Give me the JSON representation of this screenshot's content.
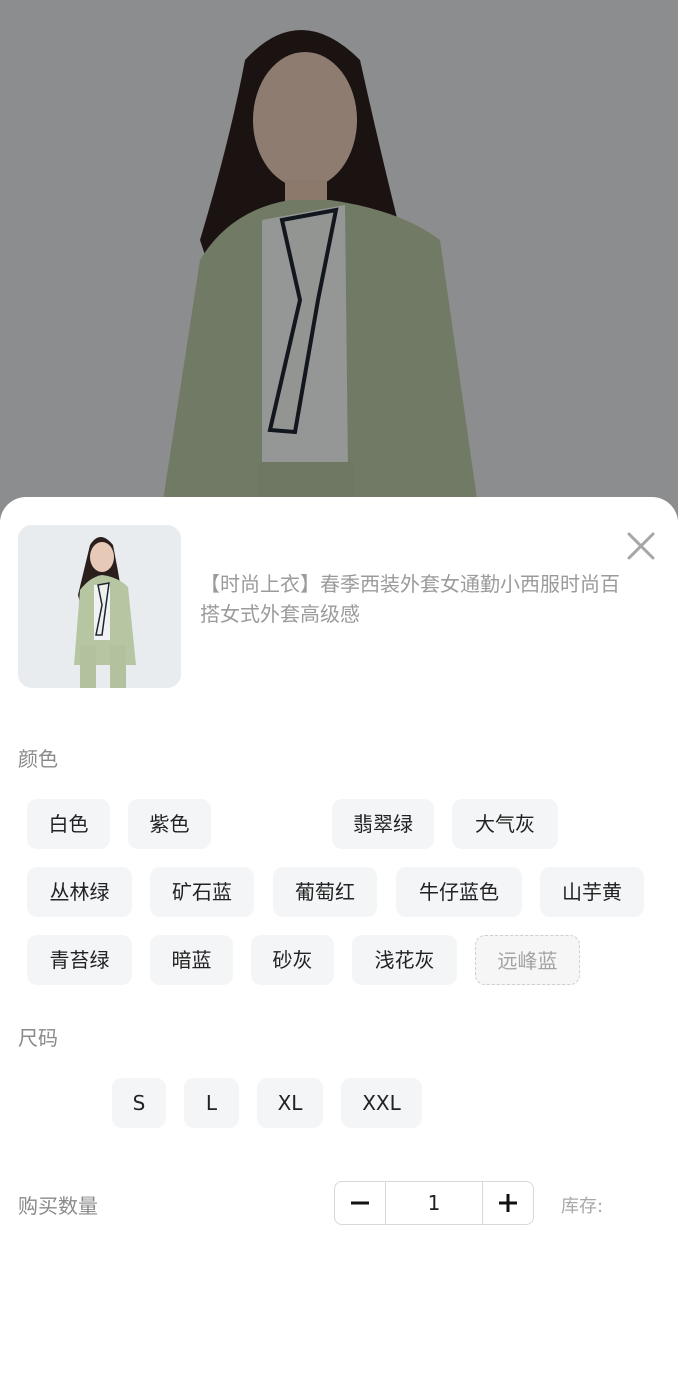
{
  "product": {
    "title": "【时尚上衣】春季西装外套女通勤小西服时尚百搭女式外套高级感",
    "image_icon": "product-photo"
  },
  "close_icon": "close-icon",
  "color": {
    "label": "颜色",
    "options": [
      {
        "label": "白色",
        "available": true
      },
      {
        "label": "紫色",
        "available": true
      },
      {
        "label": "翡翠绿",
        "available": true
      },
      {
        "label": "大气灰",
        "available": true
      },
      {
        "label": "丛林绿",
        "available": true
      },
      {
        "label": "矿石蓝",
        "available": true
      },
      {
        "label": "葡萄红",
        "available": true
      },
      {
        "label": "牛仔蓝色",
        "available": true
      },
      {
        "label": "山芋黄",
        "available": true
      },
      {
        "label": "青苔绿",
        "available": true
      },
      {
        "label": "暗蓝",
        "available": true
      },
      {
        "label": "砂灰",
        "available": true
      },
      {
        "label": "浅花灰",
        "available": true
      },
      {
        "label": "远峰蓝",
        "available": false
      }
    ]
  },
  "size": {
    "label": "尺码",
    "options": [
      {
        "label": "S"
      },
      {
        "label": "L"
      },
      {
        "label": "XL"
      },
      {
        "label": "XXL"
      }
    ]
  },
  "quantity": {
    "label": "购买数量",
    "value": "1",
    "minus_icon": "minus-icon",
    "plus_icon": "plus-icon"
  },
  "stock": {
    "label": "库存:"
  }
}
